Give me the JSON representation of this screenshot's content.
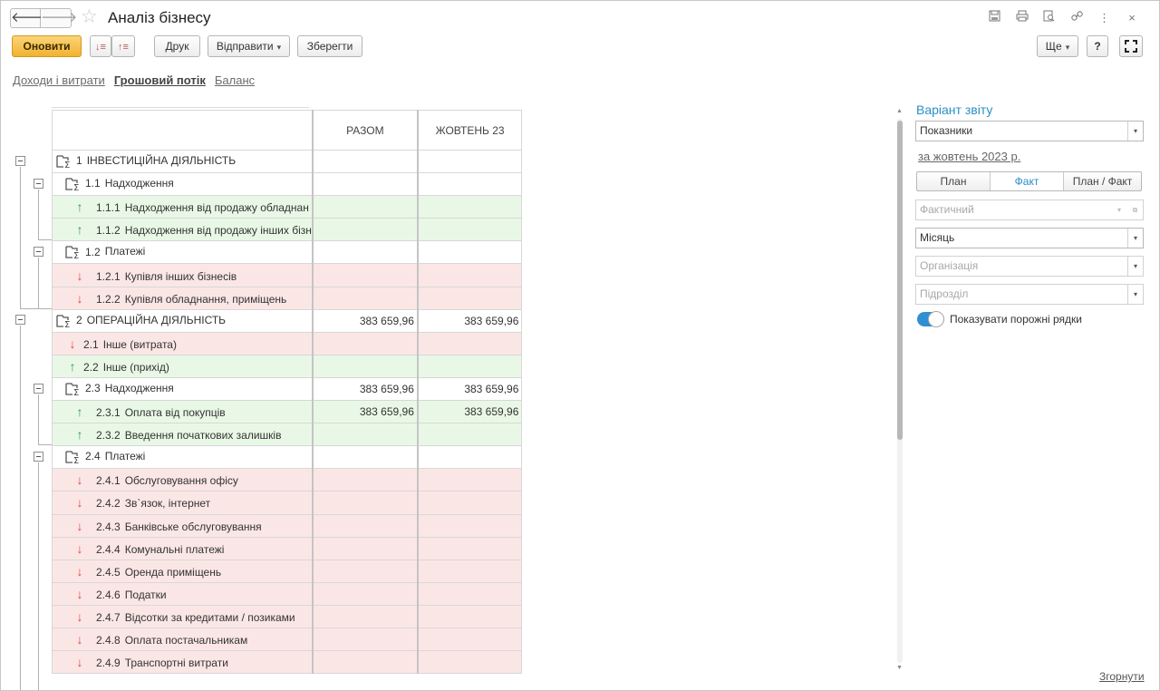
{
  "window": {
    "title": "Аналіз бізнесу",
    "tool_icons": [
      "save-icon",
      "print-icon",
      "preview-icon",
      "link-icon",
      "more-icon",
      "close-icon"
    ]
  },
  "toolbar": {
    "refresh_label": "Оновити",
    "print_label": "Друк",
    "send_label": "Відправити",
    "save_label": "Зберегти",
    "more_label": "Ще",
    "help_label": "?"
  },
  "tabs": [
    {
      "label": "Доходи і витрати",
      "active": false
    },
    {
      "label": "Грошовий потік",
      "active": true
    },
    {
      "label": "Баланс",
      "active": false
    }
  ],
  "report": {
    "columns": [
      "",
      "РАЗОМ",
      "ЖОВТЕНЬ 23"
    ],
    "rows": [
      {
        "type": "grp",
        "level": 0,
        "code": "1",
        "name": "ІНВЕСТИЦІЙНА ДІЯЛЬНІСТЬ",
        "total": "",
        "oct": ""
      },
      {
        "type": "grp",
        "level": 1,
        "code": "1.1",
        "name": "Надходження",
        "total": "",
        "oct": ""
      },
      {
        "type": "in",
        "level": 2,
        "code": "1.1.1",
        "name": "Надходження від продажу обладнан",
        "total": "",
        "oct": ""
      },
      {
        "type": "in",
        "level": 2,
        "code": "1.1.2",
        "name": "Надходження від продажу інших бізн",
        "total": "",
        "oct": ""
      },
      {
        "type": "grp",
        "level": 1,
        "code": "1.2",
        "name": "Платежі",
        "total": "",
        "oct": ""
      },
      {
        "type": "out",
        "level": 2,
        "code": "1.2.1",
        "name": "Купівля інших бізнесів",
        "total": "",
        "oct": ""
      },
      {
        "type": "out",
        "level": 2,
        "code": "1.2.2",
        "name": "Купівля обладнання, приміщень",
        "total": "",
        "oct": ""
      },
      {
        "type": "grp",
        "level": 0,
        "code": "2",
        "name": "ОПЕРАЦІЙНА ДІЯЛЬНІСТЬ",
        "total": "383 659,96",
        "oct": "383 659,96"
      },
      {
        "type": "out",
        "level": 1,
        "code": "2.1",
        "name": "Інше (витрата)",
        "total": "",
        "oct": ""
      },
      {
        "type": "in",
        "level": 1,
        "code": "2.2",
        "name": "Інше (прихід)",
        "total": "",
        "oct": ""
      },
      {
        "type": "grp",
        "level": 1,
        "code": "2.3",
        "name": "Надходження",
        "total": "383 659,96",
        "oct": "383 659,96"
      },
      {
        "type": "in",
        "level": 2,
        "code": "2.3.1",
        "name": "Оплата від покупців",
        "total": "383 659,96",
        "oct": "383 659,96"
      },
      {
        "type": "in",
        "level": 2,
        "code": "2.3.2",
        "name": "Введення початкових залишків",
        "total": "",
        "oct": ""
      },
      {
        "type": "grp",
        "level": 1,
        "code": "2.4",
        "name": "Платежі",
        "total": "",
        "oct": ""
      },
      {
        "type": "out",
        "level": 2,
        "code": "2.4.1",
        "name": "Обслуговування офісу",
        "total": "",
        "oct": ""
      },
      {
        "type": "out",
        "level": 2,
        "code": "2.4.2",
        "name": "Зв`язок, інтернет",
        "total": "",
        "oct": ""
      },
      {
        "type": "out",
        "level": 2,
        "code": "2.4.3",
        "name": "Банківське обслуговування",
        "total": "",
        "oct": ""
      },
      {
        "type": "out",
        "level": 2,
        "code": "2.4.4",
        "name": "Комунальні платежі",
        "total": "",
        "oct": ""
      },
      {
        "type": "out",
        "level": 2,
        "code": "2.4.5",
        "name": "Оренда приміщень",
        "total": "",
        "oct": ""
      },
      {
        "type": "out",
        "level": 2,
        "code": "2.4.6",
        "name": "Податки",
        "total": "",
        "oct": ""
      },
      {
        "type": "out",
        "level": 2,
        "code": "2.4.7",
        "name": "Відсотки за кредитами / позиками",
        "total": "",
        "oct": ""
      },
      {
        "type": "out",
        "level": 2,
        "code": "2.4.8",
        "name": "Оплата постачальникам",
        "total": "",
        "oct": ""
      },
      {
        "type": "out",
        "level": 2,
        "code": "2.4.9",
        "name": "Транспортні витрати",
        "total": "",
        "oct": ""
      }
    ]
  },
  "panel": {
    "title": "Варіант звіту",
    "variant_value": "Показники",
    "period_link": "за жовтень 2023 р.",
    "mode_buttons": [
      {
        "label": "План",
        "active": false
      },
      {
        "label": "Факт",
        "active": true
      },
      {
        "label": "План / Факт",
        "active": false
      }
    ],
    "scenario_placeholder": "Фактичний",
    "periodicity_value": "Місяць",
    "organization_placeholder": "Організація",
    "department_placeholder": "Підрозділ",
    "show_empty_label": "Показувати порожні рядки",
    "show_empty_on": true,
    "collapse_label": "Згорнути"
  },
  "colors": {
    "accent": "#2b8fc5",
    "primary_button": "#f3bb3c",
    "income_row": "#e9f8e6",
    "expense_row": "#fbe6e6",
    "income_arrow": "#2c9a45",
    "expense_arrow": "#e0493f"
  }
}
